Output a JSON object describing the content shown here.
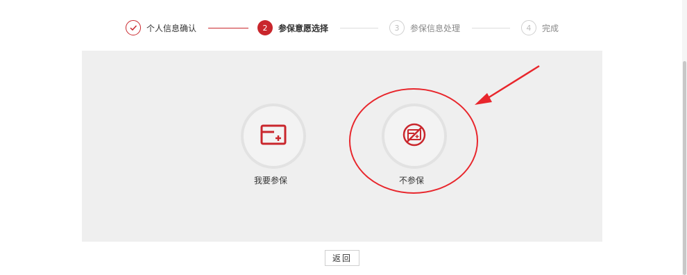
{
  "stepper": {
    "steps": [
      {
        "number": "✓",
        "label": "个人信息确认",
        "state": "done"
      },
      {
        "number": "2",
        "label": "参保意愿选择",
        "state": "active"
      },
      {
        "number": "3",
        "label": "参保信息处理",
        "state": "todo"
      },
      {
        "number": "4",
        "label": "完成",
        "state": "todo"
      }
    ]
  },
  "options": [
    {
      "label": "我要参保",
      "icon": "insure-card-icon"
    },
    {
      "label": "不参保",
      "icon": "no-insure-icon"
    }
  ],
  "back_button": {
    "label": "返回"
  },
  "colors": {
    "accent": "#c9262c",
    "panel_bg": "#efefef",
    "annotation": "#e8262c"
  }
}
